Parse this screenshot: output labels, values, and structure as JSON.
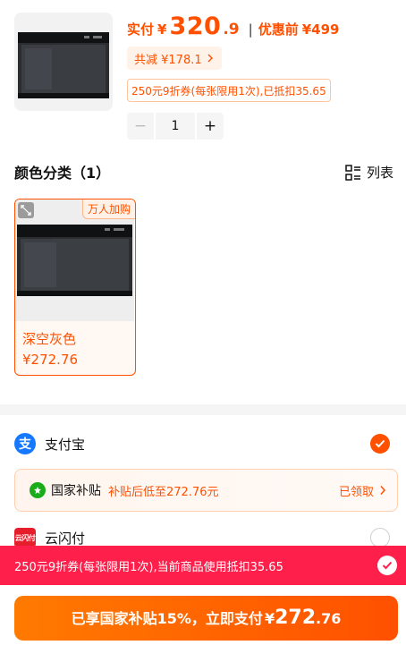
{
  "summary": {
    "paid_label": "实付",
    "currency": "¥",
    "price_int": "320",
    "price_dec": ".9",
    "separator": "|",
    "original_label": "优惠前",
    "original_price": "¥499",
    "discount_text": "共减 ¥178.1",
    "coupon_text": "250元9折券(每张限用1次),已抵扣35.65",
    "quantity": "1",
    "minus": "−",
    "plus": "+"
  },
  "variants": {
    "section_title": "颜色分类（1）",
    "view_label": "列表",
    "items": [
      {
        "badge": "万人加购",
        "name": "深空灰色",
        "price": "¥272.76"
      }
    ]
  },
  "payment": {
    "alipay": {
      "name": "支付宝",
      "icon_char": "支",
      "selected": true
    },
    "subsidy": {
      "title": "国家补贴",
      "desc": "补贴后低至272.76元",
      "status": "已领取"
    },
    "unionpay": {
      "name": "云闪付",
      "icon_char": "云闪付",
      "selected": false
    }
  },
  "coupon_banner": {
    "text": "250元9折券(每张限用1次),当前商品使用抵扣35.65",
    "checked": true
  },
  "pay_button": {
    "prefix": "已享国家补贴15%，立即支付",
    "currency": "¥",
    "amount_int": "272",
    "amount_dec": ".76"
  },
  "colors": {
    "accent": "#ff5000",
    "banner": "#ff1f4b",
    "alipay": "#1677ff",
    "subsidy_green": "#1aad19"
  }
}
